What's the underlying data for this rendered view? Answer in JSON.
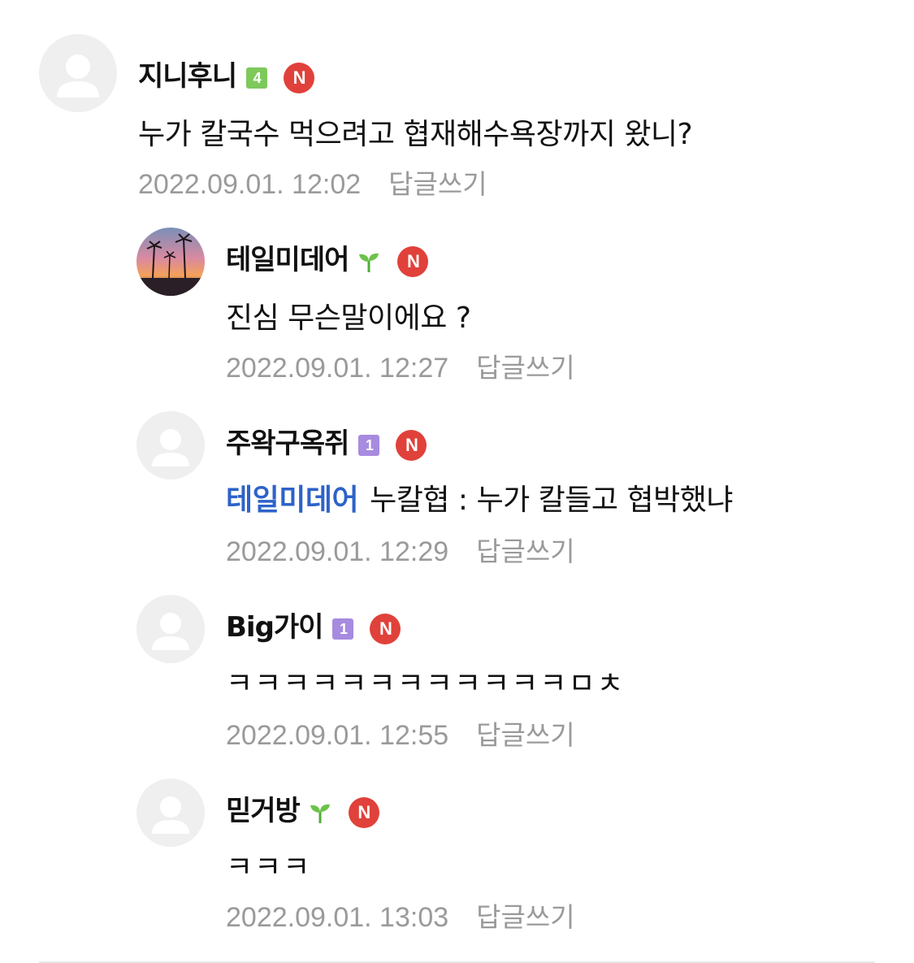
{
  "comments": [
    {
      "author": "지니후니",
      "level": "4",
      "level_color": "#7ec95c",
      "n_badge": "N",
      "text": "누가 칼국수 먹으려고 협재해수욕장까지 왔니?",
      "date": "2022.09.01. 12:02",
      "reply_label": "답글쓰기"
    },
    {
      "author": "테일미데어",
      "level_icon": "sprout-icon",
      "n_badge": "N",
      "text": "진심 무슨말이에요 ?",
      "date": "2022.09.01. 12:27",
      "reply_label": "답글쓰기"
    },
    {
      "author": "주왁구옥쥐",
      "level": "1",
      "level_color": "#a78be0",
      "n_badge": "N",
      "mention": "테일미데어",
      "text": "누칼협 : 누가 칼들고 협박했냐",
      "date": "2022.09.01. 12:29",
      "reply_label": "답글쓰기"
    },
    {
      "author": "Big가이",
      "level": "1",
      "level_color": "#a78be0",
      "n_badge": "N",
      "text": "ㅋㅋㅋㅋㅋㅋㅋㅋㅋㅋㅋㅋㅁㅊ",
      "date": "2022.09.01. 12:55",
      "reply_label": "답글쓰기"
    },
    {
      "author": "믿거방",
      "level_icon": "sprout-icon",
      "n_badge": "N",
      "text": "ㅋㅋㅋ",
      "date": "2022.09.01. 13:03",
      "reply_label": "답글쓰기"
    }
  ]
}
